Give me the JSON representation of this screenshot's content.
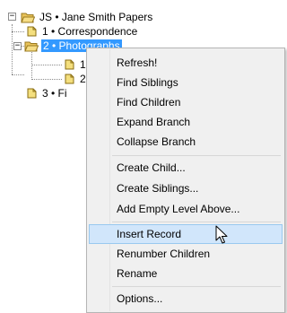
{
  "tree": {
    "root": {
      "expander": "−",
      "label": "JS • Jane Smith Papers"
    },
    "items": [
      {
        "label": "1 • Correspondence"
      },
      {
        "label": "2 • Photographs",
        "expander": "−",
        "selected": true
      },
      {
        "label": "1 •"
      },
      {
        "label": "2 •"
      },
      {
        "label": "3 • Fi"
      }
    ]
  },
  "context_menu": {
    "items": [
      {
        "label": "Refresh!"
      },
      {
        "label": "Find Siblings"
      },
      {
        "label": "Find Children"
      },
      {
        "label": "Expand Branch"
      },
      {
        "label": "Collapse Branch"
      },
      {
        "label": "Create Child..."
      },
      {
        "label": "Create Siblings..."
      },
      {
        "label": "Add Empty Level Above..."
      },
      {
        "label": "Insert Record",
        "hovered": true
      },
      {
        "label": "Renumber Children"
      },
      {
        "label": "Rename"
      },
      {
        "label": "Options..."
      }
    ]
  },
  "colors": {
    "selection": "#3399ff",
    "menu_background": "#f0f0f0",
    "menu_hover": "#d1e6fb"
  }
}
